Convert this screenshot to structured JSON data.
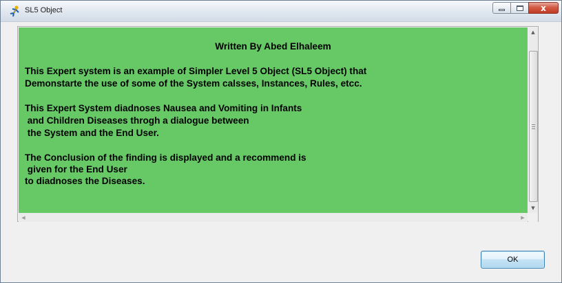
{
  "window": {
    "title": "SL5 Object",
    "app_icon": "yellow-stickman-icon",
    "controls": {
      "minimize_icon": "minimize-icon",
      "maximize_icon": "maximize-icon",
      "close_icon": "close-icon",
      "close_glyph": "x"
    }
  },
  "content": {
    "background_color": "#66c966",
    "heading": "Written By Abed Elhaleem",
    "lines": [
      "This Expert system is an example of Simpler Level 5 Object (SL5 Object) that",
      "Demonstarte the use of some of the System calsses, Instances, Rules, etcc.",
      "This Expert System diadnoses Nausea and Vomiting in Infants",
      " and Children Diseases throgh a dialogue between",
      " the System and the End User.",
      "The Conclusion of the finding is displayed and a recommend is",
      " given for the End User",
      "to diadnoses the Diseases."
    ]
  },
  "scrollbars": {
    "vertical": {
      "up_arrow": "▲",
      "down_arrow": "▼"
    },
    "horizontal": {
      "left_arrow": "◀",
      "right_arrow": "▶"
    }
  },
  "buttons": {
    "ok_label": "OK"
  }
}
